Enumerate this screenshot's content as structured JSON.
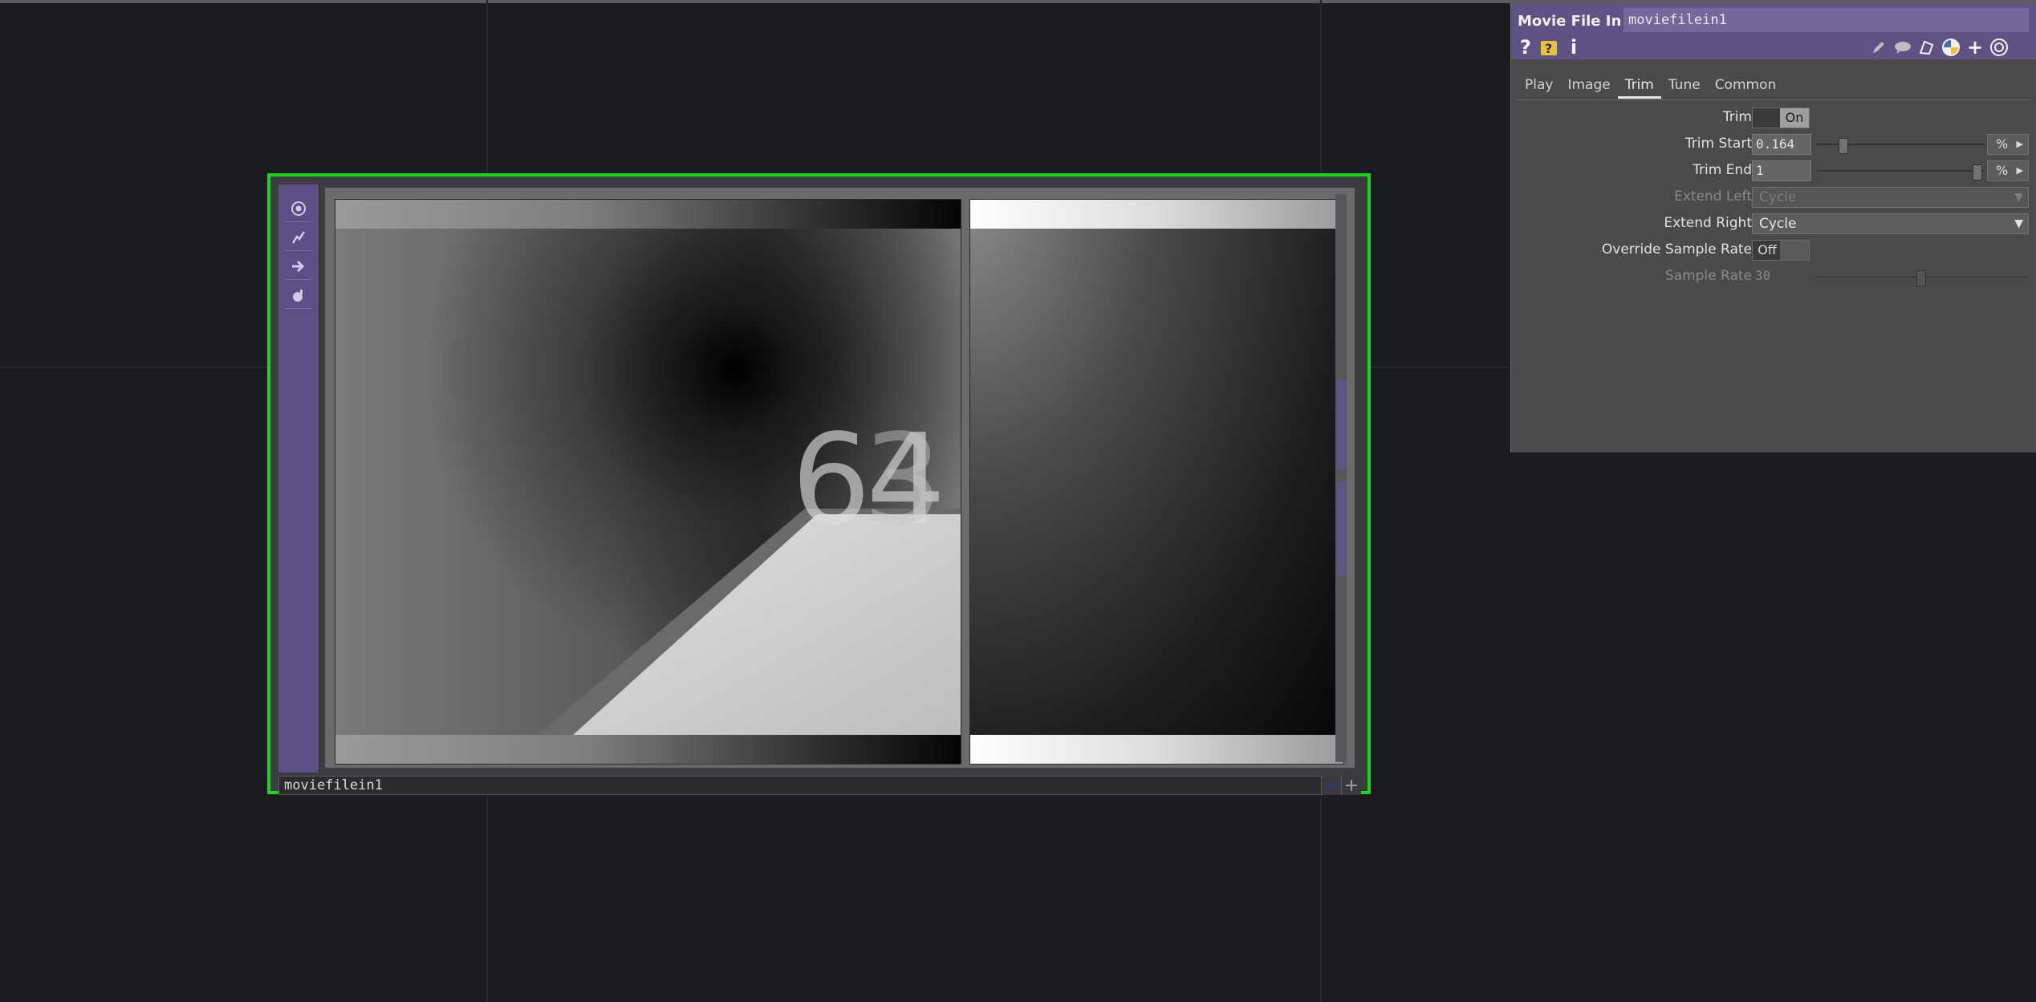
{
  "node": {
    "name": "moviefilein1",
    "preview_digits": "64",
    "preview_digits_overlay": "3"
  },
  "panel": {
    "op_type": "Movie File In",
    "op_name": "moviefilein1",
    "header_icons": [
      "help-icon",
      "python-help-icon",
      "info-icon",
      "edit-icon",
      "comment-icon",
      "clone-icon",
      "python-icon",
      "add-icon",
      "target-icon"
    ],
    "tabs": [
      "Play",
      "Image",
      "Trim",
      "Tune",
      "Common"
    ],
    "active_tab": "Trim",
    "params": {
      "trim": {
        "label": "Trim",
        "value": "On"
      },
      "trim_start": {
        "label": "Trim Start",
        "value": "0.164",
        "unit": "%",
        "slider": 0.164
      },
      "trim_end": {
        "label": "Trim End",
        "value": "1",
        "unit": "%",
        "slider": 1.0
      },
      "extend_left": {
        "label": "Extend Left",
        "value": "Cycle"
      },
      "extend_right": {
        "label": "Extend Right",
        "value": "Cycle"
      },
      "override_sample_rate": {
        "label": "Override Sample Rate",
        "value": "Off"
      },
      "sample_rate": {
        "label": "Sample Rate",
        "value": "30"
      }
    }
  }
}
